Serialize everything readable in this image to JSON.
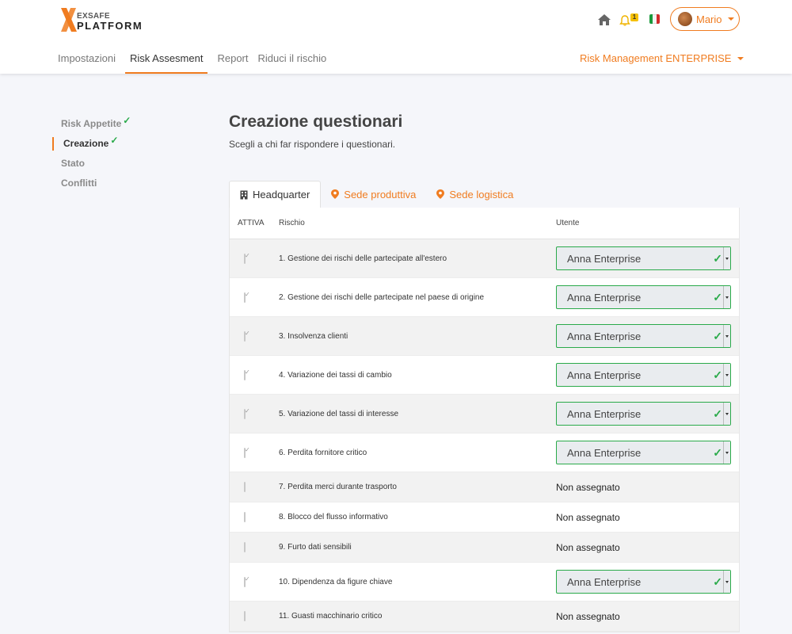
{
  "brand": {
    "line1": "EXSAFE",
    "line2": "PLATFORM",
    "accent": "#f07c20"
  },
  "header": {
    "notification_count": "1",
    "user_name": "Mario",
    "environment": "Risk Management ENTERPRISE"
  },
  "nav": {
    "items": [
      {
        "label": "Impostazioni"
      },
      {
        "label": "Risk Assesment"
      },
      {
        "label": "Report"
      },
      {
        "label": "Riduci il rischio"
      }
    ]
  },
  "sidebar": {
    "items": [
      {
        "label": "Risk Appetite",
        "done": true
      },
      {
        "label": "Creazione",
        "done": true
      },
      {
        "label": "Stato",
        "done": false
      },
      {
        "label": "Conflitti",
        "done": false
      }
    ],
    "check_glyph": "✓"
  },
  "main": {
    "title": "Creazione questionari",
    "subtitle": "Scegli a chi far rispondere i questionari."
  },
  "tabs": [
    {
      "label": "Headquarter",
      "icon": "building-icon"
    },
    {
      "label": "Sede produttiva",
      "icon": "map-pin-icon"
    },
    {
      "label": "Sede logistica",
      "icon": "map-pin-icon"
    }
  ],
  "table": {
    "headers": {
      "active": "ATTIVA",
      "risk": "Rischio",
      "user": "Utente"
    },
    "rows": [
      {
        "active": true,
        "risk": "1. Gestione dei rischi delle partecipate all'estero",
        "user": "Anna Enterprise"
      },
      {
        "active": true,
        "risk": "2. Gestione dei rischi delle partecipate nel paese di origine",
        "user": "Anna Enterprise"
      },
      {
        "active": true,
        "risk": "3. Insolvenza clienti",
        "user": "Anna Enterprise"
      },
      {
        "active": true,
        "risk": "4. Variazione dei tassi di cambio",
        "user": "Anna Enterprise"
      },
      {
        "active": true,
        "risk": "5. Variazione del tassi di interesse",
        "user": "Anna Enterprise"
      },
      {
        "active": true,
        "risk": "6. Perdita fornitore critico",
        "user": "Anna Enterprise"
      },
      {
        "active": false,
        "risk": "7. Perdita merci durante trasporto",
        "user": "Non assegnato"
      },
      {
        "active": false,
        "risk": "8. Blocco del flusso informativo",
        "user": "Non assegnato"
      },
      {
        "active": false,
        "risk": "9. Furto dati sensibili",
        "user": "Non assegnato"
      },
      {
        "active": true,
        "risk": "10. Dipendenza da figure chiave",
        "user": "Anna Enterprise"
      },
      {
        "active": false,
        "risk": "11. Guasti macchinario critico",
        "user": "Non assegnato"
      }
    ]
  }
}
